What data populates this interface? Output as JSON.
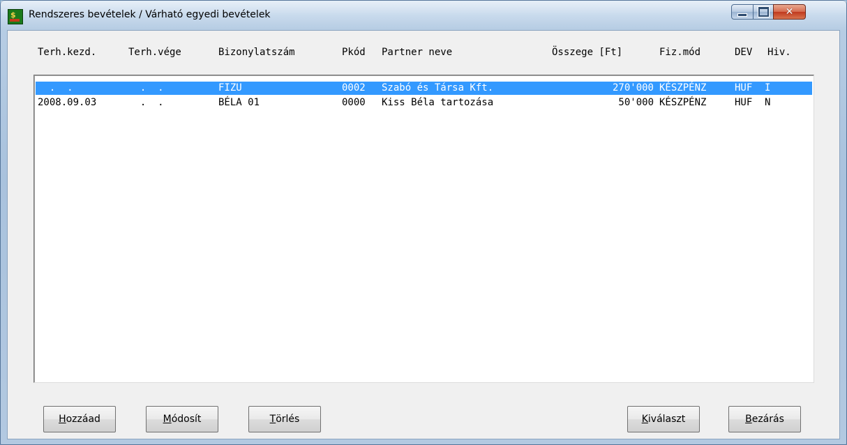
{
  "window": {
    "title": "Rendszeres bevételek / Várható egyedi bevételek",
    "icon": "app-money-icon"
  },
  "columns": [
    {
      "key": "start",
      "label": "Terh.kezd."
    },
    {
      "key": "end",
      "label": "Terh.vége"
    },
    {
      "key": "doc",
      "label": "Bizonylatszám"
    },
    {
      "key": "pcode",
      "label": "Pkód"
    },
    {
      "key": "partner",
      "label": "Partner neve"
    },
    {
      "key": "amount",
      "label": "Összege [Ft]"
    },
    {
      "key": "paymode",
      "label": "Fiz.mód"
    },
    {
      "key": "currency",
      "label": "DEV"
    },
    {
      "key": "official",
      "label": "Hiv."
    }
  ],
  "rows": [
    {
      "start": "  .  .",
      "end": "  .  .",
      "doc": "FIZU",
      "pcode": "0002",
      "partner": "Szabó és Társa Kft.",
      "amount": "270'000",
      "paymode": "KÉSZPÉNZ",
      "currency": "HUF",
      "official": "I",
      "selected": true
    },
    {
      "start": "2008.09.03",
      "end": "  .  .",
      "doc": "BÉLA 01",
      "pcode": "0000",
      "partner": "Kiss Béla tartozása",
      "amount": "50'000",
      "paymode": "KÉSZPÉNZ",
      "currency": "HUF",
      "official": "N",
      "selected": false
    }
  ],
  "buttons": {
    "add": {
      "mnemonic": "H",
      "rest": "ozzáad"
    },
    "modify": {
      "mnemonic": "M",
      "rest": "ódosít"
    },
    "delete": {
      "mnemonic": "T",
      "rest": "örlés"
    },
    "select": {
      "mnemonic": "K",
      "rest": "iválaszt"
    },
    "close": {
      "mnemonic": "B",
      "rest": "ezárás"
    }
  },
  "colors": {
    "selection": "#3399ff",
    "close_button": "#c0391e"
  }
}
